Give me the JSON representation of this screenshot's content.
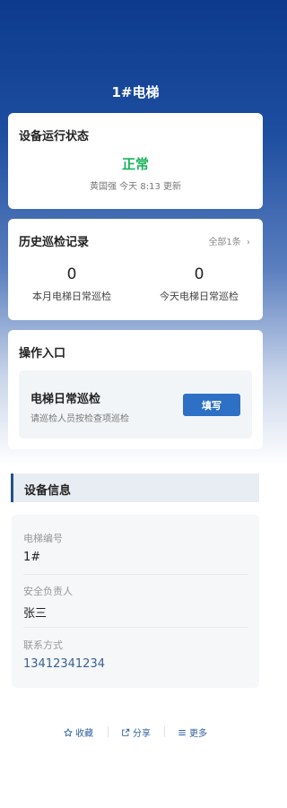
{
  "header": {
    "title": "1#电梯"
  },
  "status": {
    "title": "设备运行状态",
    "value": "正常",
    "meta": "黄国强 今天 8:13 更新"
  },
  "history": {
    "title": "历史巡检记录",
    "all_label": "全部1条",
    "stats": [
      {
        "value": "0",
        "label": "本月电梯日常巡检"
      },
      {
        "value": "0",
        "label": "今天电梯日常巡检"
      }
    ]
  },
  "ops": {
    "title": "操作入口",
    "task_title": "电梯日常巡检",
    "task_desc": "请巡检人员按检查项巡检",
    "button_label": "填写"
  },
  "device": {
    "section_title": "设备信息",
    "fields": [
      {
        "label": "电梯编号",
        "value": "1#"
      },
      {
        "label": "安全负责人",
        "value": "张三"
      },
      {
        "label": "联系方式",
        "value": "13412341234"
      }
    ]
  },
  "footer": {
    "favorite": "收藏",
    "share": "分享",
    "more": "更多"
  },
  "colors": {
    "accent": "#2d70c5",
    "status_ok": "#19b35b",
    "header_bg": "#0d3a8c"
  }
}
